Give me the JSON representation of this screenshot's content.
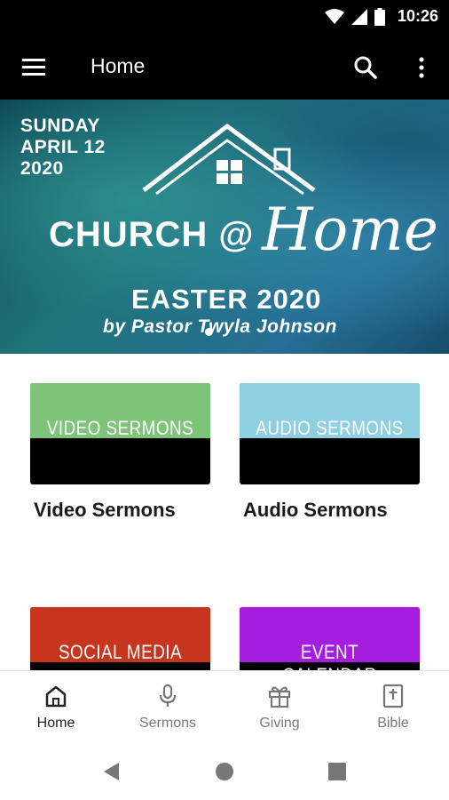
{
  "status_bar": {
    "time": "10:26",
    "icons": [
      "wifi-icon",
      "signal-icon",
      "battery-icon"
    ]
  },
  "app_bar": {
    "title": "Home",
    "icons": [
      "menu-icon",
      "search-icon",
      "more-vert-icon"
    ]
  },
  "banner": {
    "date_line1": "SUNDAY",
    "date_line2": "APRIL 12",
    "date_line3": "2020",
    "church_text": "CHURCH @",
    "home_text": "Home",
    "event_title": "EASTER 2020",
    "byline": "by  Pastor Twyla Johnson"
  },
  "tiles": [
    {
      "image_text": "VIDEO SERMONS",
      "label": "Video Sermons",
      "color": "#7ec57a"
    },
    {
      "image_text": "AUDIO SERMONS",
      "label": "Audio Sermons",
      "color": "#8fd0e0"
    },
    {
      "image_text": "SOCIAL MEDIA",
      "label": "",
      "color": "#c6361f"
    },
    {
      "image_text": "EVENT CALENDAR",
      "label": "",
      "color": "#a51ee0"
    }
  ],
  "bottom_nav": [
    {
      "label": "Home",
      "icon": "home-icon",
      "active": true
    },
    {
      "label": "Sermons",
      "icon": "microphone-icon",
      "active": false
    },
    {
      "label": "Giving",
      "icon": "gift-icon",
      "active": false
    },
    {
      "label": "Bible",
      "icon": "bible-icon",
      "active": false
    }
  ],
  "system_nav": [
    "back-icon",
    "home-circle-icon",
    "recents-icon"
  ]
}
